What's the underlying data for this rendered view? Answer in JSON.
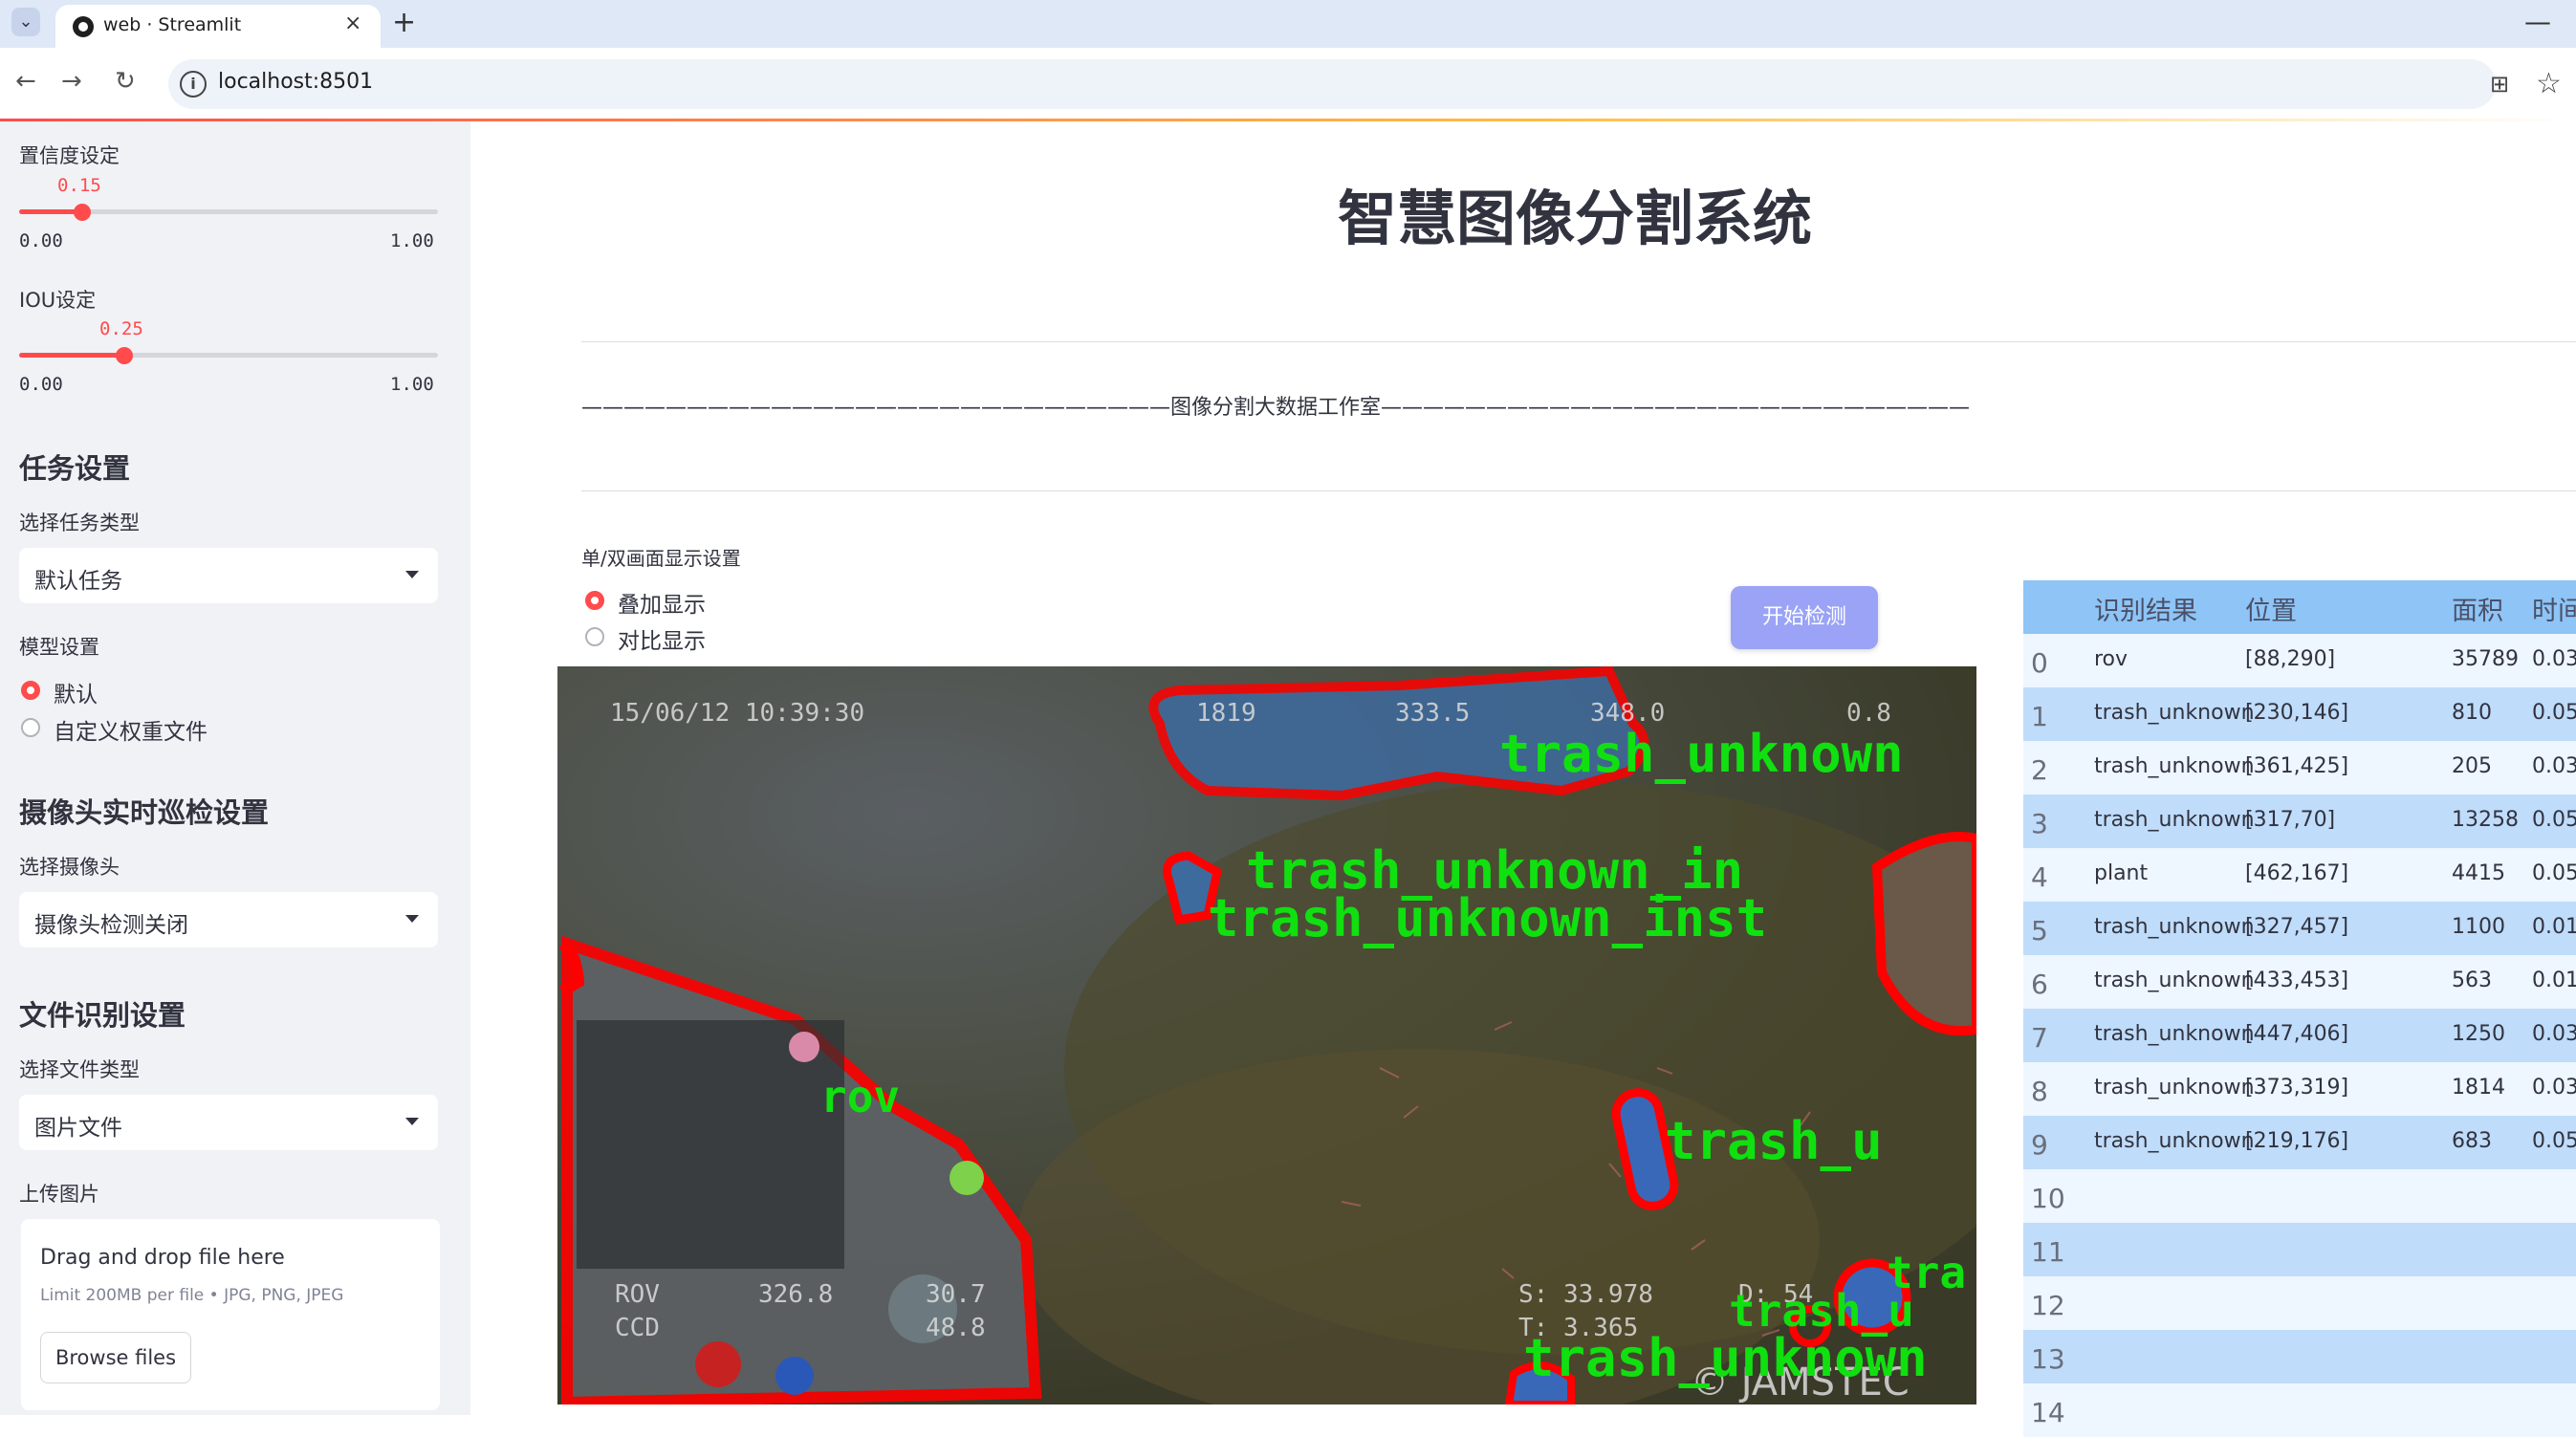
{
  "browser": {
    "tab_title": "web · Streamlit",
    "tab_close": "×",
    "new_tab": "+",
    "minimize": "—",
    "url": "localhost:8501",
    "back": "←",
    "forward": "→",
    "reload": "↻"
  },
  "sidebar": {
    "conf_label": "置信度设定",
    "conf_value": "0.15",
    "conf_min": "0.00",
    "conf_max": "1.00",
    "conf_fraction": 0.15,
    "iou_label": "IOU设定",
    "iou_value": "0.25",
    "iou_min": "0.00",
    "iou_max": "1.00",
    "iou_fraction": 0.25,
    "task_header": "任务设置",
    "task_type_label": "选择任务类型",
    "task_type_value": "默认任务",
    "model_label": "模型设置",
    "model_opt1": "默认",
    "model_opt2": "自定义权重文件",
    "camera_header": "摄像头实时巡检设置",
    "camera_label": "选择摄像头",
    "camera_value": "摄像头检测关闭",
    "file_header": "文件识别设置",
    "file_type_label": "选择文件类型",
    "file_type_value": "图片文件",
    "upload_label": "上传图片",
    "drop_text": "Drag and drop file here",
    "limit_text": "Limit 200MB per file • JPG, PNG, JPEG",
    "browse_label": "Browse files"
  },
  "main": {
    "title": "智慧图像分割系统",
    "divider_text": "————————————————————————————图像分割大数据工作室————————————————————————————",
    "display_label": "单/双画面显示设置",
    "display_opt1": "叠加显示",
    "display_opt2": "对比显示",
    "detect_button": "开始检测"
  },
  "image": {
    "osd_date": "15/06/12  10:39:30",
    "osd_1": "1819",
    "osd_2": "333.5",
    "osd_3": "348.0",
    "osd_4": "0.8",
    "osd_s": "S: 33.978",
    "osd_t": "T: 3.365",
    "osd_d": "D: 54",
    "osd_ccd": "CCD",
    "osd_rov": "ROV",
    "osd_v1": "326.8",
    "osd_v2": "30.7",
    "osd_v3": "48.8",
    "watermark": "© JAMSTEC",
    "labels": [
      "trash_unknown",
      "trash_unknown_in",
      "trash_unknown_inst",
      "rov",
      "trash_u",
      "tra",
      "trash_u",
      "trash_unknown"
    ]
  },
  "table": {
    "headers": [
      "识别结果",
      "位置",
      "面积",
      "时间"
    ],
    "rows": [
      {
        "idx": "0",
        "label": "rov",
        "pos": "[88,290]",
        "area": "35789",
        "time": "0.03"
      },
      {
        "idx": "1",
        "label": "trash_unknown",
        "pos": "[230,146]",
        "area": "810",
        "time": "0.05"
      },
      {
        "idx": "2",
        "label": "trash_unknown",
        "pos": "[361,425]",
        "area": "205",
        "time": "0.03"
      },
      {
        "idx": "3",
        "label": "trash_unknown",
        "pos": "[317,70]",
        "area": "13258",
        "time": "0.05"
      },
      {
        "idx": "4",
        "label": "plant",
        "pos": "[462,167]",
        "area": "4415",
        "time": "0.05"
      },
      {
        "idx": "5",
        "label": "trash_unknown",
        "pos": "[327,457]",
        "area": "1100",
        "time": "0.01"
      },
      {
        "idx": "6",
        "label": "trash_unknown",
        "pos": "[433,453]",
        "area": "563",
        "time": "0.01"
      },
      {
        "idx": "7",
        "label": "trash_unknown",
        "pos": "[447,406]",
        "area": "1250",
        "time": "0.03"
      },
      {
        "idx": "8",
        "label": "trash_unknown",
        "pos": "[373,319]",
        "area": "1814",
        "time": "0.03"
      },
      {
        "idx": "9",
        "label": "trash_unknown",
        "pos": "[219,176]",
        "area": "683",
        "time": "0.05"
      },
      {
        "idx": "10",
        "label": "",
        "pos": "",
        "area": "",
        "time": ""
      },
      {
        "idx": "11",
        "label": "",
        "pos": "",
        "area": "",
        "time": ""
      },
      {
        "idx": "12",
        "label": "",
        "pos": "",
        "area": "",
        "time": ""
      },
      {
        "idx": "13",
        "label": "",
        "pos": "",
        "area": "",
        "time": ""
      },
      {
        "idx": "14",
        "label": "",
        "pos": "",
        "area": "",
        "time": ""
      }
    ]
  },
  "colors": {
    "accent": "#ff4b4b",
    "sidebar_bg": "#f0f2f6",
    "mask_outline": "#ff0000",
    "mask_label": "#00e000",
    "button": "#9aa3f5",
    "table_head": "#8ec4f6",
    "table_odd": "#bfdcfb",
    "table_even": "#eef6ff"
  }
}
